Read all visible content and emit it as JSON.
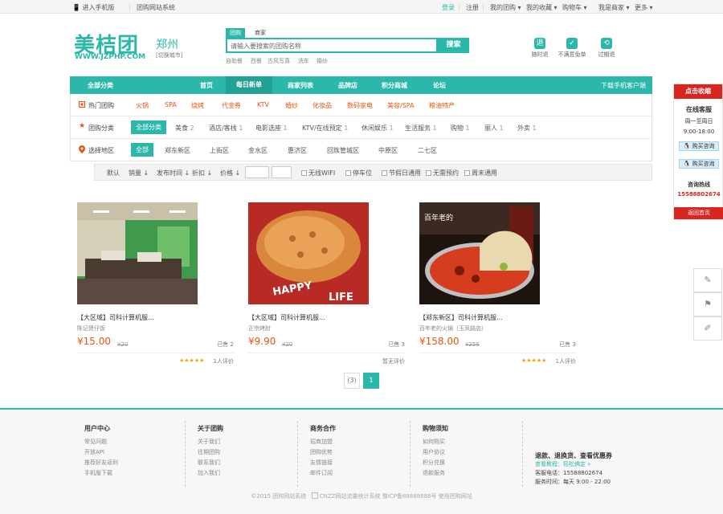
{
  "topbar": {
    "mobile": "进入手机版",
    "site_name": "团购网站系统",
    "login": "登录",
    "register": "注册",
    "my_tuan": "我的团购",
    "favorites": "我的收藏",
    "cart": "购物车",
    "merchant": "我是商家",
    "more": "更多"
  },
  "logo": {
    "name": "美桔团",
    "url": "WWW.JZPHP.COM",
    "city": "郑州",
    "switch": "[切换城市]"
  },
  "search": {
    "tabs": [
      "团购",
      "商家"
    ],
    "placeholder": "请输入要搜索的团购名称",
    "button": "搜索",
    "hot": [
      "自助餐",
      "西餐",
      "古风写真",
      "洗车",
      "婚纱"
    ]
  },
  "promises": [
    {
      "icon": "退",
      "label": "随时退"
    },
    {
      "icon": "✓",
      "label": "不满意免单"
    },
    {
      "icon": "⟲",
      "label": "过期退"
    }
  ],
  "nav": {
    "all": "全部分类",
    "items": [
      "首页",
      "每日新单",
      "商家列表",
      "品牌店",
      "积分商城",
      "论坛"
    ],
    "download": "下载手机客户端"
  },
  "filter": {
    "hot": {
      "label": "热门团购",
      "items": [
        "火锅",
        "SPA",
        "烧烤",
        "代金券",
        "KTV",
        "婚纱",
        "化妆品",
        "数码家电",
        "美容/SPA",
        "粮油特产"
      ]
    },
    "cat": {
      "label": "团购分类",
      "selected": "全部分类",
      "items": [
        {
          "name": "美食",
          "count": "2"
        },
        {
          "name": "酒店/客栈",
          "count": "1"
        },
        {
          "name": "电影选座",
          "count": "1"
        },
        {
          "name": "KTV/在线预定",
          "count": "1"
        },
        {
          "name": "休闲娱乐",
          "count": "1"
        },
        {
          "name": "生活服务",
          "count": "1"
        },
        {
          "name": "购物",
          "count": "1"
        },
        {
          "name": "丽人",
          "count": "1"
        },
        {
          "name": "外卖",
          "count": "1"
        }
      ]
    },
    "area": {
      "label": "选择地区",
      "selected": "全部",
      "items": [
        "郑东新区",
        "上街区",
        "金水区",
        "惠济区",
        "回族管城区",
        "中原区",
        "二七区"
      ]
    }
  },
  "sort": {
    "items": [
      "默认",
      "销量",
      "发布时间",
      "折扣",
      "价格"
    ],
    "checks": [
      "无线WIFI",
      "停车位",
      "节假日通用",
      "无需预约",
      "周末通用"
    ]
  },
  "products": [
    {
      "title": "【大区域】司科计算机服...",
      "sub": "陈记煲仔饭",
      "price": "¥15.00",
      "old": "¥20",
      "sold": "已售 2",
      "stars": "★★★★★",
      "reviews": "1人评价"
    },
    {
      "title": "【大区域】司科计算机服...",
      "sub": "正宗烤肘",
      "price": "¥9.90",
      "old": "¥20",
      "sold": "已售 3",
      "stars": "",
      "reviews": "暂无评价"
    },
    {
      "title": "【郑东新区】司科计算机服...",
      "sub": "百年老的火锅（玉凤路店）",
      "price": "¥158.00",
      "old": "¥256",
      "sold": "已售 3",
      "stars": "★★★★★",
      "reviews": "1人评价"
    }
  ],
  "product_img_text": {
    "happy": "HAPPY",
    "life": "LIFE",
    "brand": "百年老的"
  },
  "pagination": {
    "total": "(3)",
    "current": "1"
  },
  "side": {
    "header": "点击收缩",
    "title": "在线客服",
    "days": "周一至周日",
    "hours": "9:00-18:00",
    "qq1": "购买咨询",
    "qq2": "购买咨询",
    "hotline_label": "咨询热线",
    "hotline": "15588802674",
    "home": "返回首页"
  },
  "footer": {
    "cols": [
      {
        "title": "用户中心",
        "links": [
          "常见问题",
          "开放API",
          "推荐好友返利",
          "手机版下载"
        ]
      },
      {
        "title": "关于团购",
        "links": [
          "关于我们",
          "往期团购",
          "联系我们",
          "加入我们"
        ]
      },
      {
        "title": "商务合作",
        "links": [
          "招商加盟",
          "团购优势",
          "友情链接",
          "邮件订阅"
        ]
      },
      {
        "title": "购物须知",
        "links": [
          "如何购买",
          "用户协议",
          "积分兑换",
          "退款服务"
        ]
      }
    ],
    "service_title": "退款、退换货、查看优惠券",
    "service_link": "查看教程：轻松搞定 »",
    "phone": "客服电话：15588802674",
    "time": "服务时间：每天 9:00 - 22:00",
    "copyright": "©2015 团购网站系统",
    "stat": "CNZZ网站流量统计系统",
    "icp": "豫ICP备88888888号",
    "powered": "使用团购网站"
  },
  "colors": {
    "brand": "#2bb8aa",
    "price": "#e8550d",
    "red": "#d8261f"
  }
}
